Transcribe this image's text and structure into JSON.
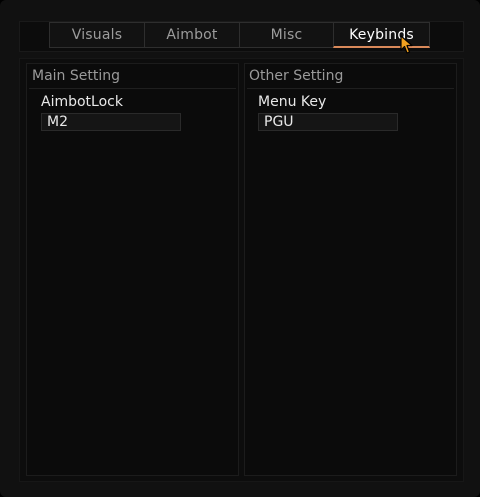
{
  "tabs": [
    {
      "label": "Visuals",
      "active": false
    },
    {
      "label": "Aimbot",
      "active": false
    },
    {
      "label": "Misc",
      "active": false
    },
    {
      "label": "Keybinds",
      "active": true
    }
  ],
  "accent_color": "#d9895a",
  "main_setting": {
    "title": "Main Setting",
    "label": "AimbotLock",
    "value": "M2"
  },
  "other_setting": {
    "title": "Other Setting",
    "label": "Menu Key",
    "value": "PGU"
  },
  "cursor_icon": "pointer-cursor-icon"
}
